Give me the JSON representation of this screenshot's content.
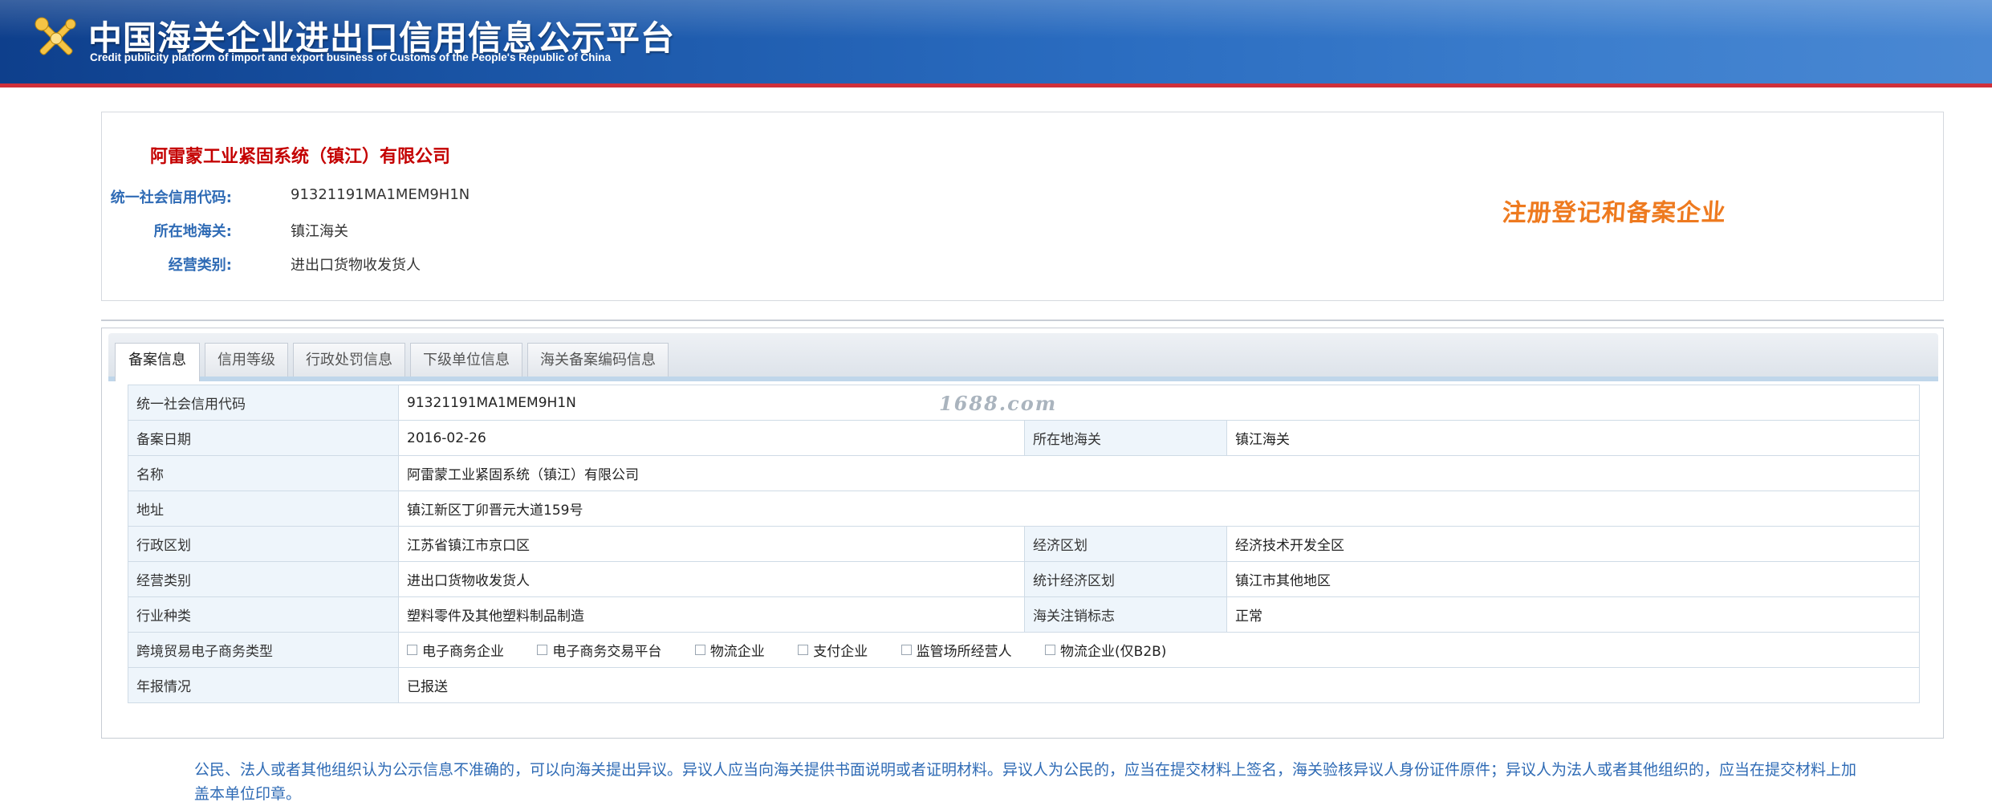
{
  "header": {
    "title": "中国海关企业进出口信用信息公示平台",
    "subtitle": "Credit publicity platform of import and export business of Customs of the People's Republic of China",
    "logo_icon": "customs-emblem-icon"
  },
  "company": {
    "name": "阿雷蒙工业紧固系统（镇江）有限公司",
    "fields": [
      {
        "label": "统一社会信用代码:",
        "value": "91321191MA1MEM9H1N"
      },
      {
        "label": "所在地海关:",
        "value": "镇江海关"
      },
      {
        "label": "经营类别:",
        "value": "进出口货物收发货人"
      }
    ],
    "stamp": "注册登记和备案企业"
  },
  "tabs": [
    {
      "label": "备案信息",
      "active": true
    },
    {
      "label": "信用等级",
      "active": false
    },
    {
      "label": "行政处罚信息",
      "active": false
    },
    {
      "label": "下级单位信息",
      "active": false
    },
    {
      "label": "海关备案编码信息",
      "active": false
    }
  ],
  "record": {
    "credit_code_label": "统一社会信用代码",
    "credit_code": "91321191MA1MEM9H1N",
    "date_label": "备案日期",
    "date": "2016-02-26",
    "customs_label": "所在地海关",
    "customs": "镇江海关",
    "name_label": "名称",
    "name": "阿雷蒙工业紧固系统（镇江）有限公司",
    "address_label": "地址",
    "address": "镇江新区丁卯晋元大道159号",
    "admin_region_label": "行政区划",
    "admin_region": "江苏省镇江市京口区",
    "econ_zone_label": "经济区划",
    "econ_zone": "经济技术开发全区",
    "business_type_label": "经营类别",
    "business_type": "进出口货物收发货人",
    "stat_zone_label": "统计经济区划",
    "stat_zone": "镇江市其他地区",
    "industry_label": "行业种类",
    "industry": "塑料零件及其他塑料制品制造",
    "cancel_flag_label": "海关注销标志",
    "cancel_flag": "正常",
    "ecommerce_label": "跨境贸易电子商务类型",
    "ecommerce_options": [
      "电子商务企业",
      "电子商务交易平台",
      "物流企业",
      "支付企业",
      "监管场所经营人",
      "物流企业(仅B2B)"
    ],
    "annual_report_label": "年报情况",
    "annual_report": "已报送"
  },
  "watermark": "1688.com",
  "notice": "公民、法人或者其他组织认为公示信息不准确的，可以向海关提出异议。异议人应当向海关提供书面说明或者证明材料。异议人为公民的，应当在提交材料上签名，海关验核异议人身份证件原件；异议人为法人或者其他组织的，应当在提交材料上加盖本单位印章。",
  "colors": {
    "header_blue": "#1a55a6",
    "header_red_line": "#d0303a",
    "company_name": "#c40000",
    "label_blue": "#2f6bb5",
    "stamp_orange": "#ee7a1f"
  }
}
